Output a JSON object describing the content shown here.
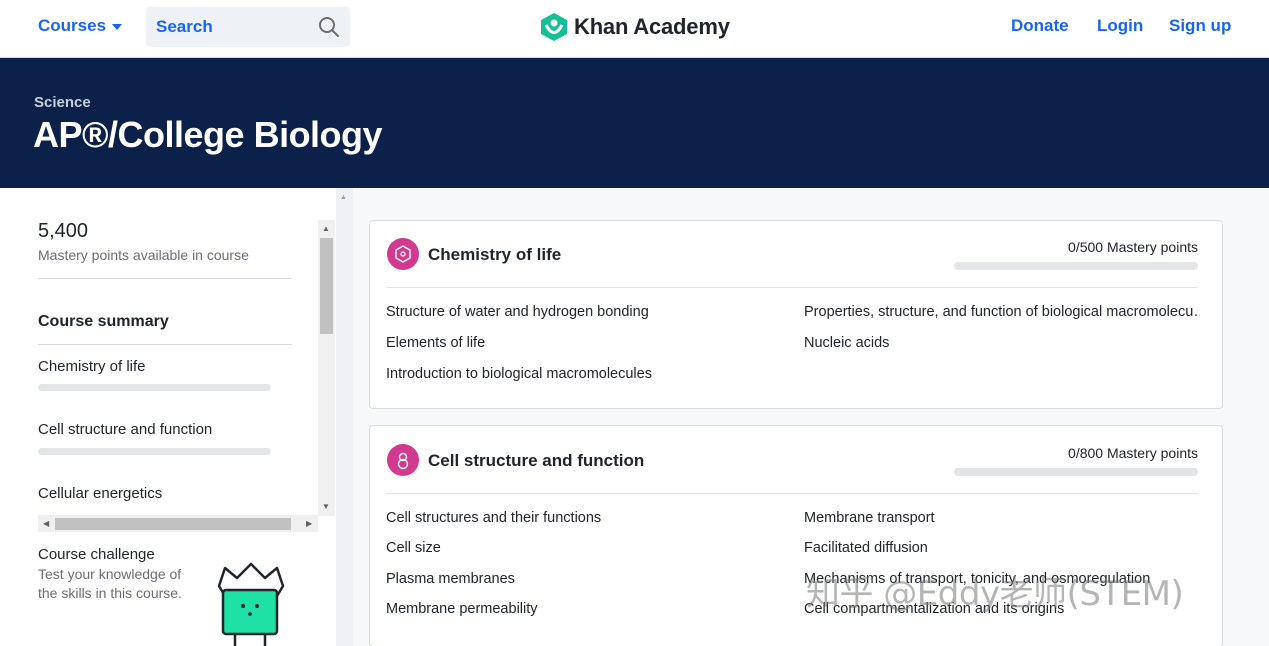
{
  "nav": {
    "courses_label": "Courses",
    "search_placeholder": "Search",
    "logo_text": "Khan Academy",
    "donate_label": "Donate",
    "login_label": "Login",
    "signup_label": "Sign up"
  },
  "header": {
    "breadcrumb": "Science",
    "title": "AP®/College Biology"
  },
  "sidebar": {
    "points": "5,400",
    "points_caption": "Mastery points available in course",
    "summary_title": "Course summary",
    "items": [
      {
        "label": "Chemistry of life"
      },
      {
        "label": "Cell structure and function"
      },
      {
        "label": "Cellular energetics"
      }
    ],
    "challenge_title": "Course challenge",
    "challenge_text": "Test your knowledge of the skills in this course."
  },
  "units": [
    {
      "title": "Chemistry of life",
      "mastery": "0/500 Mastery points",
      "progress": 0,
      "lessons_left": [
        "Structure of water and hydrogen bonding",
        "Elements of life",
        "Introduction to biological macromolecules"
      ],
      "lessons_right": [
        "Properties, structure, and function of biological macromolecu…",
        "Nucleic acids"
      ]
    },
    {
      "title": "Cell structure and function",
      "mastery": "0/800 Mastery points",
      "progress": 0,
      "lessons_left": [
        "Cell structures and their functions",
        "Cell size",
        "Plasma membranes",
        "Membrane permeability"
      ],
      "lessons_right": [
        "Membrane transport",
        "Facilitated diffusion",
        "Mechanisms of transport, tonicity, and osmoregulation",
        "Cell compartmentalization and its origins"
      ]
    }
  ],
  "watermark": "知乎 @Eddy老师(STEM)",
  "colors": {
    "brand_blue": "#1865f2",
    "banner_navy": "#0b2149",
    "unit_icon": "#d13a8f",
    "logo_green": "#14bf96"
  }
}
